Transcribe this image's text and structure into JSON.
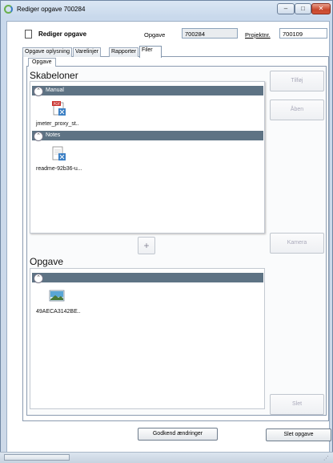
{
  "window": {
    "title": "Rediger opgave 700284",
    "min_glyph": "–",
    "max_glyph": "□",
    "close_glyph": "✕"
  },
  "header": {
    "form_title": "Rediger opgave",
    "opgave_label": "Opgave",
    "opgave_value": "700284",
    "projekt_label": "Projektnr.",
    "projekt_value": "700109"
  },
  "tabs": [
    {
      "label": "Opgave oplysning"
    },
    {
      "label": "Varelinjer"
    },
    {
      "label": "Rapporter"
    },
    {
      "label": "Filer"
    }
  ],
  "inner_tab": {
    "label": "Opgave"
  },
  "skabeloner": {
    "title": "Skabeloner",
    "groups": [
      {
        "name": "Manual",
        "file": "jmeter_proxy_st.."
      },
      {
        "name": "Notes",
        "file": "readme-92b36-u..."
      }
    ]
  },
  "opgave_files": {
    "title": "Opgave",
    "group_name": "",
    "file": "49AECA3142BE.."
  },
  "buttons": {
    "tilfoj": "Tilføj",
    "aaben": "Åben",
    "kamera": "Kamera",
    "slet": "Slet",
    "plus": "+",
    "godkend": "Godkend ændringer",
    "slet_opgave": "Slet opgave"
  },
  "icons": {
    "chevron_up": "⌃",
    "grip": "⋰"
  },
  "colors": {
    "group_bar": "#5e7384",
    "pdf_red": "#c9302c",
    "doc_blue": "#3b7fc4"
  }
}
